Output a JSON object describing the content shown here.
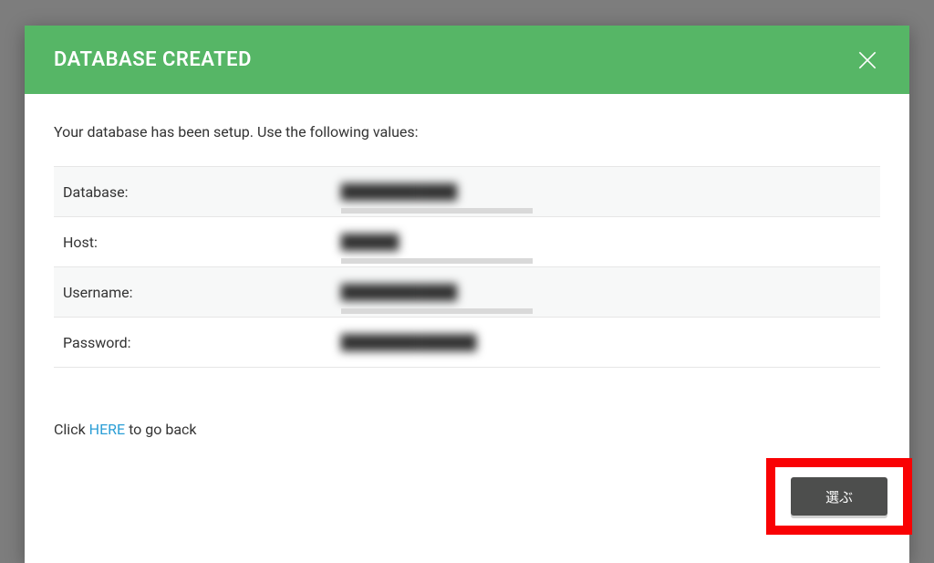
{
  "modal": {
    "title": "DATABASE CREATED",
    "intro": "Your database has been setup. Use the following values:",
    "rows": {
      "database": {
        "label": "Database:",
        "value": "████████████"
      },
      "host": {
        "label": "Host:",
        "value": "██████"
      },
      "username": {
        "label": "Username:",
        "value": "████████████"
      },
      "password": {
        "label": "Password:",
        "value": "██████████████"
      }
    },
    "back": {
      "prefix": "Click ",
      "link": "HERE",
      "suffix": " to go back"
    },
    "select_button": "選ぶ"
  }
}
